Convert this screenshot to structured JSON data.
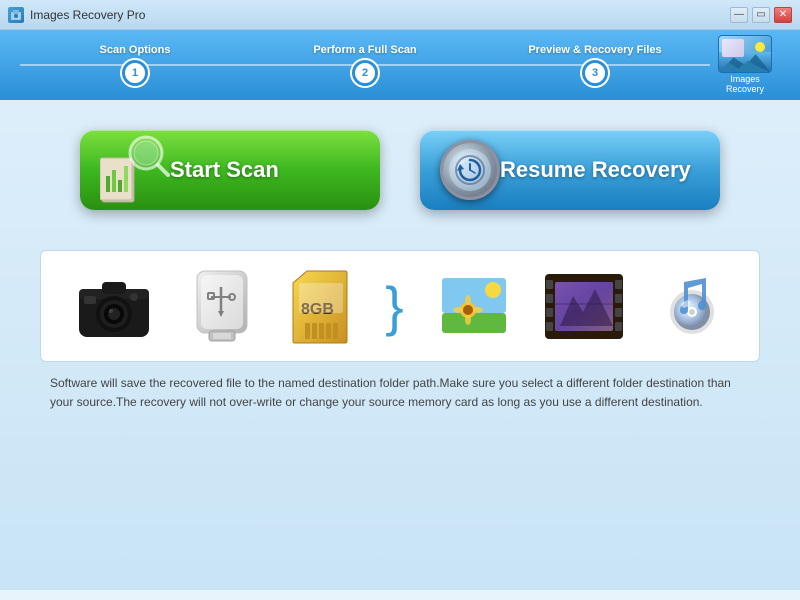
{
  "titleBar": {
    "title": "Images Recovery Pro",
    "iconLabel": "img",
    "minimizeBtn": "—",
    "maximizeBtn": "▭",
    "closeBtn": "✕"
  },
  "wizard": {
    "steps": [
      {
        "number": "1",
        "label": "Scan Options"
      },
      {
        "number": "2",
        "label": "Perform a Full Scan"
      },
      {
        "number": "3",
        "label": "Preview & Recovery Files"
      }
    ],
    "logoLine1": "Images",
    "logoLine2": "Recovery"
  },
  "buttons": {
    "startScan": "Start Scan",
    "resumeRecovery": "Resume Recovery"
  },
  "infoText": "Software will save the recovered file to the named destination folder path.Make sure you select a different folder destination than your source.The recovery will not over-write or change your source memory card as long as you use a different destination."
}
